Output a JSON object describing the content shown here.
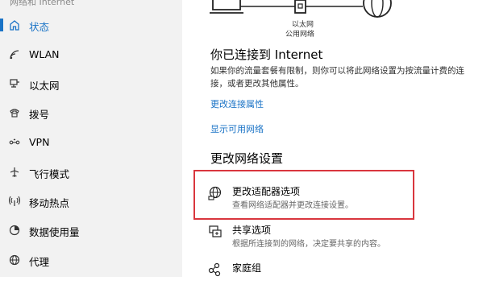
{
  "sidebar": {
    "header": "网络和 Internet",
    "items": [
      {
        "label": "状态",
        "icon": "home-icon",
        "active": true
      },
      {
        "label": "WLAN",
        "icon": "wifi-icon"
      },
      {
        "label": "以太网",
        "icon": "ethernet-icon"
      },
      {
        "label": "拨号",
        "icon": "dialup-icon"
      },
      {
        "label": "VPN",
        "icon": "vpn-icon"
      },
      {
        "label": "飞行模式",
        "icon": "airplane-icon"
      },
      {
        "label": "移动热点",
        "icon": "hotspot-icon"
      },
      {
        "label": "数据使用量",
        "icon": "data-usage-icon"
      },
      {
        "label": "代理",
        "icon": "globe-icon"
      }
    ]
  },
  "diagram": {
    "adapter_name": "以太网",
    "network_type": "公用网络"
  },
  "status": {
    "heading": "你已连接到 Internet",
    "description": "如果你的流量套餐有限制，则你可以将此网络设置为按流量计费的连接，或者更改其他属性。"
  },
  "links": {
    "change_properties": "更改连接属性",
    "show_networks": "显示可用网络"
  },
  "change_section": {
    "heading": "更改网络设置",
    "options": [
      {
        "title": "更改适配器选项",
        "desc": "查看网络适配器并更改连接设置。",
        "icon": "adapter-icon"
      },
      {
        "title": "共享选项",
        "desc": "根据所连接到的网络，决定要共享的内容。",
        "icon": "sharing-icon"
      },
      {
        "title": "家庭组",
        "desc": "",
        "icon": "homegroup-icon"
      }
    ]
  },
  "colors": {
    "accent": "#1a73c6",
    "highlight_border": "#d9363e",
    "sidebar_bg": "#f2f2f2"
  }
}
